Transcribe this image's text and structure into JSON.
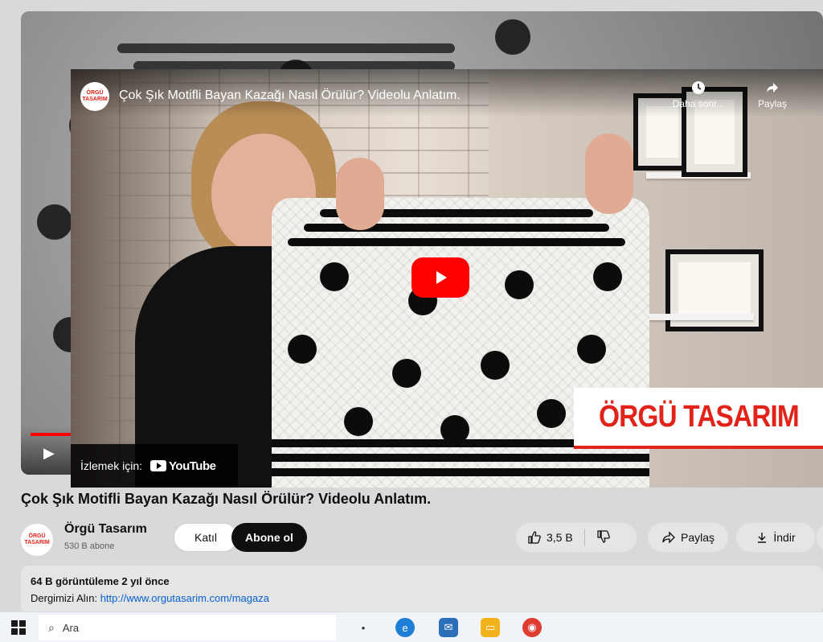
{
  "embed": {
    "title": "Çok Şık Motifli Bayan Kazağı Nasıl Örülür? Videolu Anlatım.",
    "channel_logo_line1": "ÖRGÜ",
    "channel_logo_line2": "TASARIM",
    "watch_later_label": "Daha sonr...",
    "share_label": "Paylaş",
    "watch_on_label": "İzlemek için:",
    "youtube_wordmark": "YouTube",
    "brand_overlay_text": "ÖRGÜ TASARIM"
  },
  "video": {
    "title": "Çok Şık Motifli Bayan Kazağı Nasıl Örülür? Videolu Anlatım.",
    "channel_name": "Örgü Tasarım",
    "subscribers": "530 B abone",
    "join_label": "Katıl",
    "subscribe_label": "Abone ol",
    "like_count": "3,5 B",
    "share_label": "Paylaş",
    "download_label": "İndir"
  },
  "description": {
    "meta": "64 B görüntüleme  2 yıl önce",
    "line2_prefix": "Dergimizi Alın: ",
    "line2_link": "http://www.orgutasarim.com/magaza"
  },
  "taskbar": {
    "search_placeholder": "Ara"
  },
  "colors": {
    "brand_red": "#e2231a",
    "yt_red": "#ff0000",
    "link_blue": "#065fd4"
  }
}
